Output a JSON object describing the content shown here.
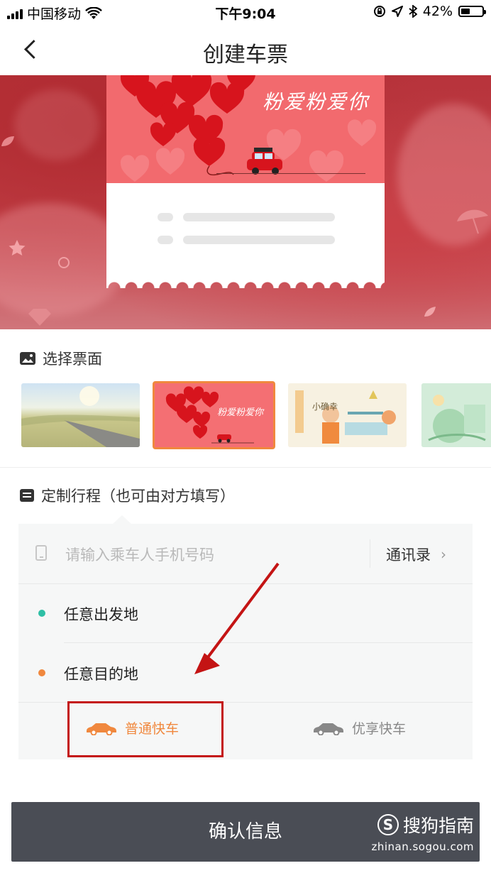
{
  "status_bar": {
    "carrier": "中国移动",
    "time": "下午9:04",
    "battery": "42%",
    "battery_level": 0.42
  },
  "nav": {
    "title": "创建车票"
  },
  "hero": {
    "ticket_title": "粉爱粉爱你"
  },
  "choose_face": {
    "title": "选择票面",
    "thumbs": [
      {
        "name": "road-landscape",
        "selected": false
      },
      {
        "name": "hearts-car",
        "title": "粉爱粉爱你",
        "selected": true
      },
      {
        "name": "cafe-illustration",
        "title": "小确幸",
        "selected": false
      },
      {
        "name": "green-illustration",
        "selected": false
      }
    ]
  },
  "trip": {
    "title": "定制行程（也可由对方填写）",
    "phone_placeholder": "请输入乘车人手机号码",
    "contacts_label": "通讯录",
    "contacts_chevron": "›",
    "departure": "任意出发地",
    "destination": "任意目的地",
    "car_options": [
      {
        "label": "普通快车",
        "selected": true
      },
      {
        "label": "优享快车",
        "selected": false
      }
    ]
  },
  "colors": {
    "accent": "#f0883e",
    "departure_dot": "#2ebfa5",
    "destination_dot": "#f0883e",
    "button_bg": "#4a4d55",
    "annotation": "#c41414"
  },
  "confirm": {
    "label": "确认信息"
  },
  "watermark": {
    "logo_letter": "S",
    "brand": "搜狗指南",
    "url": "zhinan.sogou.com"
  }
}
